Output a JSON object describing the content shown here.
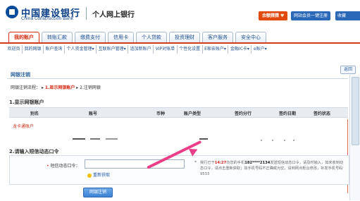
{
  "header": {
    "bank_cn": "中国建设银行",
    "bank_en": "China Construction Bank",
    "system": "个人网上银行",
    "promo": "余额猜猜",
    "quick1": "网站会员一键注册",
    "quick2": "收藏"
  },
  "tabs": [
    {
      "label": "我的账户",
      "active": true
    },
    {
      "label": "转账汇款",
      "active": false
    },
    {
      "label": "缴费支付",
      "active": false
    },
    {
      "label": "信用卡",
      "active": false
    },
    {
      "label": "个人贷款",
      "active": false
    },
    {
      "label": "投资理财",
      "active": false
    },
    {
      "label": "客户服务",
      "active": false
    },
    {
      "label": "安全中心",
      "active": false
    }
  ],
  "subnav": [
    "欢迎页",
    "我的网银",
    "账户查询",
    "个人资金管理▾",
    "互联账户管理▾",
    "追加新账户",
    "VIP对账单",
    "个性化设置",
    "E家亲账户▾",
    "金融IC卡▾",
    "e账户▾"
  ],
  "page": {
    "title": "网银注销",
    "back": "返回",
    "steps_prefix": "网银注销流程：",
    "step1": "1.显示网银账户",
    "step2": "2.注销网银",
    "sec1": "1.显示网银账户",
    "sec2": "2.请输入短信动态口令"
  },
  "table": {
    "headers": [
      "别名",
      "账号",
      "币种",
      "账户类型",
      "签约分行",
      "签约日期",
      "签约状态"
    ],
    "row1": "龙卡通账户"
  },
  "form": {
    "label": "短信动态口令：",
    "refresh": "重新获取",
    "notice_prefix": "我行已于",
    "time": "14:27",
    "notice_mid": "向您的手机",
    "phone": "182****2134",
    "notice_rest": "发送短信动态口令，请及时输入，如未收到动态口令，请点击重新获取；如手机号码不正确或为空，请到网点柜台修改，补发手机号码9533",
    "submit": "网银注销"
  },
  "colors": {
    "brand_blue": "#0a3f88",
    "accent_red": "#d63a1c",
    "arrow_pink": "#ea3f88"
  }
}
